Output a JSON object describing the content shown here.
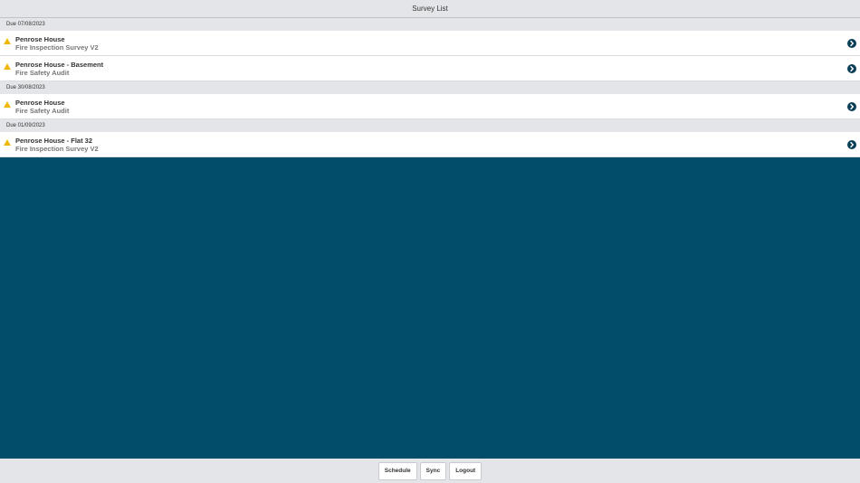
{
  "header": {
    "title": "Survey List"
  },
  "groups": [
    {
      "due": "Due 07/08/2023",
      "items": [
        {
          "title": "Penrose House",
          "subtitle": "Fire Inspection Survey V2"
        },
        {
          "title": "Penrose House - Basement",
          "subtitle": "Fire Safety Audit"
        }
      ]
    },
    {
      "due": "Due 30/08/2023",
      "items": [
        {
          "title": "Penrose House",
          "subtitle": "Fire Safety Audit"
        }
      ]
    },
    {
      "due": "Due 01/09/2023",
      "items": [
        {
          "title": "Penrose House - Flat 32",
          "subtitle": "Fire Inspection Survey V2"
        }
      ]
    }
  ],
  "footer": {
    "schedule_label": "Schedule",
    "sync_label": "Sync",
    "logout_label": "Logout"
  },
  "icons": {
    "warning": "warning-icon",
    "chevron": "chevron-right-circle-icon"
  },
  "colors": {
    "background": "#024d6a",
    "warning": "#f2b705",
    "chevron": "#0b3e57"
  }
}
